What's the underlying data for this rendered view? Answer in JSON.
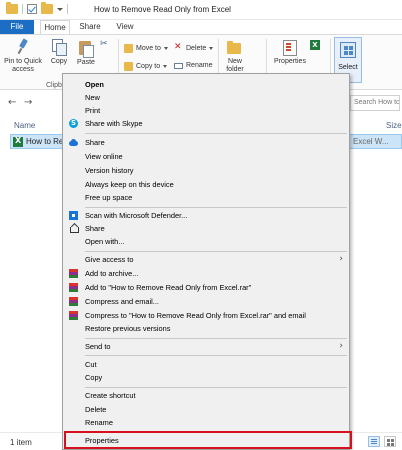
{
  "window": {
    "title": "How to Remove Read Only from Excel"
  },
  "tabs": {
    "file": "File",
    "home": "Home",
    "share": "Share",
    "view": "View"
  },
  "ribbon": {
    "pin": "Pin to Quick access",
    "copy": "Copy",
    "paste": "Paste",
    "move_to": "Move to",
    "copy_to": "Copy to",
    "delete": "Delete",
    "rename": "Rename",
    "new_folder": "New folder",
    "properties": "Properties",
    "select": "Select",
    "clipboard_group": "Clipbo"
  },
  "nav": {
    "search_placeholder": "Search How to Remo..."
  },
  "list": {
    "col_name": "Name",
    "col_size": "Size",
    "file_name": "How to Rem",
    "file_type": "Excel W..."
  },
  "status": {
    "count": "1 item",
    "selected": "1 item"
  },
  "context_menu": {
    "items": [
      {
        "label": "Open",
        "bold": true
      },
      {
        "label": "New"
      },
      {
        "label": "Print"
      },
      {
        "label": "Share with Skype",
        "icon": "skype-icon"
      },
      {
        "label": "Share",
        "icon": "onedrive-icon"
      },
      {
        "label": "View online"
      },
      {
        "label": "Version history"
      },
      {
        "label": "Always keep on this device"
      },
      {
        "label": "Free up space"
      },
      {
        "label": "Scan with Microsoft Defender...",
        "icon": "defender-icon"
      },
      {
        "label": "Share",
        "icon": "share-icon"
      },
      {
        "label": "Open with..."
      },
      {
        "label": "Give access to",
        "submenu": true
      },
      {
        "label": "Add to archive...",
        "icon": "winrar-icon"
      },
      {
        "label": "Add to \"How to Remove Read Only from Excel.rar\"",
        "icon": "winrar-icon"
      },
      {
        "label": "Compress and email...",
        "icon": "winrar-icon"
      },
      {
        "label": "Compress to \"How to Remove Read Only from Excel.rar\" and email",
        "icon": "winrar-icon"
      },
      {
        "label": "Restore previous versions"
      },
      {
        "label": "Send to",
        "submenu": true
      },
      {
        "label": "Cut"
      },
      {
        "label": "Copy"
      },
      {
        "label": "Create shortcut"
      },
      {
        "label": "Delete"
      },
      {
        "label": "Rename"
      },
      {
        "label": "Properties",
        "highlighted": true
      }
    ]
  },
  "colors": {
    "accent": "#1c6ec4",
    "highlight_border": "#d6111f",
    "selection": "#cce4f7"
  }
}
